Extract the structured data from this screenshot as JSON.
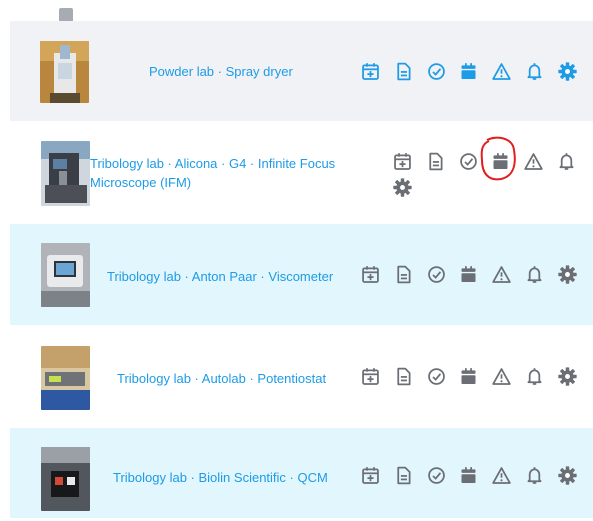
{
  "colors": {
    "icon_active": "#1e9be6",
    "icon_muted": "#6b6e74",
    "link": "#1e9be6",
    "annotation": "#e01e1e"
  },
  "icon_set": [
    "calendar-plus-icon",
    "document-icon",
    "check-circle-icon",
    "calendar-icon",
    "warning-icon",
    "bell-icon",
    "gear-icon"
  ],
  "equipment": [
    {
      "name": "Powder lab · Spray dryer",
      "icons_color": "active"
    },
    {
      "name": "Tribology lab · Alicona · G4 · Infinite Focus Microscope (IFM)",
      "icons_color": "muted"
    },
    {
      "name": "Tribology lab · Anton Paar · Viscometer",
      "icons_color": "muted"
    },
    {
      "name": "Tribology lab · Autolab · Potentiostat",
      "icons_color": "muted"
    },
    {
      "name": "Tribology lab · Biolin Scientific · QCM",
      "icons_color": "muted"
    }
  ]
}
